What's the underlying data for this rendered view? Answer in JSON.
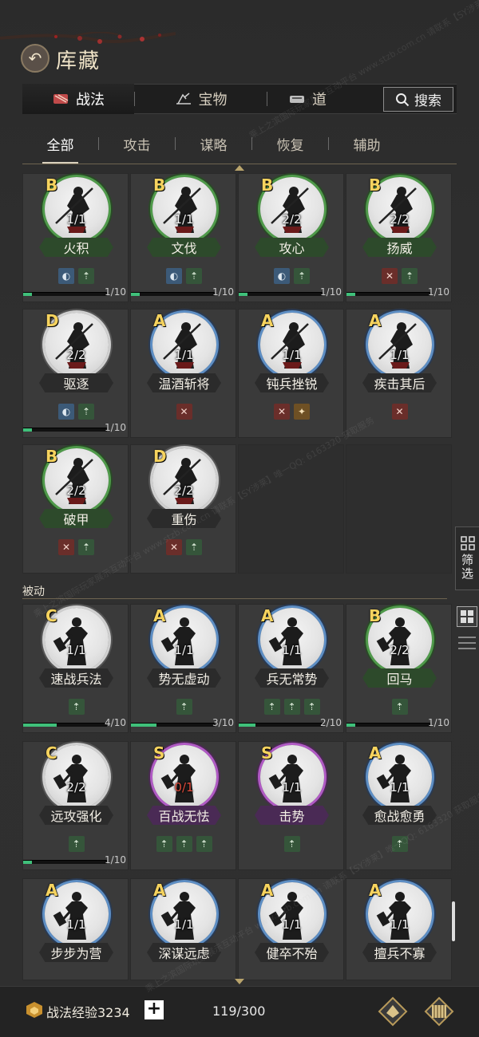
{
  "header": {
    "title": "库藏"
  },
  "main_tabs": [
    {
      "label": "战法",
      "icon": "skill-scroll-icon",
      "active": true
    },
    {
      "label": "宝物",
      "icon": "treasure-icon",
      "active": false
    },
    {
      "label": "道",
      "icon": "item-icon",
      "active": false
    }
  ],
  "search": {
    "label": "搜索"
  },
  "sub_tabs": [
    {
      "label": "全部",
      "active": true
    },
    {
      "label": "攻击",
      "active": false
    },
    {
      "label": "谋略",
      "active": false
    },
    {
      "label": "恢复",
      "active": false
    },
    {
      "label": "辅助",
      "active": false
    }
  ],
  "active_cards": [
    {
      "grade": "B",
      "count": "1/1",
      "name": "火积",
      "progress_text": "1/10",
      "progress": 0.1,
      "ring": "green",
      "tags": [
        "blue-tag",
        "green-tag"
      ]
    },
    {
      "grade": "B",
      "count": "1/1",
      "name": "文伐",
      "progress_text": "1/10",
      "progress": 0.1,
      "ring": "green",
      "tags": [
        "blue-tag",
        "green-tag"
      ]
    },
    {
      "grade": "B",
      "count": "2/2",
      "name": "攻心",
      "progress_text": "1/10",
      "progress": 0.1,
      "ring": "green",
      "tags": [
        "blue-tag",
        "green-tag"
      ]
    },
    {
      "grade": "B",
      "count": "2/2",
      "name": "扬威",
      "progress_text": "1/10",
      "progress": 0.1,
      "ring": "green",
      "tags": [
        "red-tag",
        "green-tag"
      ]
    },
    {
      "grade": "D",
      "count": "2/2",
      "name": "驱逐",
      "progress_text": "1/10",
      "progress": 0.1,
      "ring": "white",
      "tags": [
        "blue-tag",
        "green-tag"
      ]
    },
    {
      "grade": "A",
      "count": "1/1",
      "name": "温酒斩将",
      "progress_text": "",
      "progress": 0,
      "ring": "blue",
      "tags": [
        "red-tag"
      ]
    },
    {
      "grade": "A",
      "count": "1/1",
      "name": "钝兵挫锐",
      "progress_text": "",
      "progress": 0,
      "ring": "blue",
      "tags": [
        "red-tag",
        "amber-tag"
      ]
    },
    {
      "grade": "A",
      "count": "1/1",
      "name": "疾击其后",
      "progress_text": "",
      "progress": 0,
      "ring": "blue",
      "tags": [
        "red-tag"
      ]
    },
    {
      "grade": "B",
      "count": "2/2",
      "name": "破甲",
      "progress_text": "",
      "progress": 0,
      "ring": "green",
      "tags": [
        "red-tag",
        "green-tag"
      ]
    },
    {
      "grade": "D",
      "count": "2/2",
      "name": "重伤",
      "progress_text": "",
      "progress": 0,
      "ring": "white",
      "tags": [
        "red-tag",
        "green-tag"
      ]
    }
  ],
  "passive_section": {
    "title": "被动"
  },
  "passive_cards": [
    {
      "grade": "C",
      "count": "1/1",
      "name": "速战兵法",
      "progress_text": "4/10",
      "progress": 0.4,
      "ring": "white",
      "tags": [
        "green-tag"
      ]
    },
    {
      "grade": "A",
      "count": "1/1",
      "name": "势无虚动",
      "progress_text": "3/10",
      "progress": 0.3,
      "ring": "blue",
      "tags": [
        "green-tag"
      ]
    },
    {
      "grade": "A",
      "count": "1/1",
      "name": "兵无常势",
      "progress_text": "2/10",
      "progress": 0.2,
      "ring": "blue",
      "tags": [
        "green-tag",
        "green-tag",
        "green-tag"
      ]
    },
    {
      "grade": "B",
      "count": "2/2",
      "name": "回马",
      "progress_text": "1/10",
      "progress": 0.1,
      "ring": "green",
      "tags": [
        "green-tag"
      ]
    },
    {
      "grade": "C",
      "count": "2/2",
      "name": "远攻强化",
      "progress_text": "1/10",
      "progress": 0.1,
      "ring": "white",
      "tags": [
        "green-tag"
      ]
    },
    {
      "grade": "S",
      "count": "0/1",
      "name": "百战无怯",
      "progress_text": "",
      "progress": 0,
      "ring": "purple",
      "tags": [
        "green-tag",
        "green-tag",
        "green-tag"
      ]
    },
    {
      "grade": "S",
      "count": "1/1",
      "name": "击势",
      "progress_text": "",
      "progress": 0,
      "ring": "purple",
      "tags": [
        "green-tag"
      ]
    },
    {
      "grade": "A",
      "count": "1/1",
      "name": "愈战愈勇",
      "progress_text": "",
      "progress": 0,
      "ring": "blue",
      "tags": [
        "green-tag"
      ]
    },
    {
      "grade": "A",
      "count": "1/1",
      "name": "步步为营",
      "progress_text": "",
      "progress": 0,
      "ring": "blue",
      "tags": []
    },
    {
      "grade": "A",
      "count": "1/1",
      "name": "深谋远虑",
      "progress_text": "",
      "progress": 0,
      "ring": "blue",
      "tags": []
    },
    {
      "grade": "A",
      "count": "1/1",
      "name": "健卒不殆",
      "progress_text": "",
      "progress": 0,
      "ring": "blue",
      "tags": []
    },
    {
      "grade": "A",
      "count": "1/1",
      "name": "擅兵不寡",
      "progress_text": "",
      "progress": 0,
      "ring": "blue",
      "tags": []
    }
  ],
  "side": {
    "filter_label": "筛选"
  },
  "bottom": {
    "exp_label": "战法经验3234",
    "capacity": "119/300"
  },
  "watermark": {
    "text": "乘上之滨国际玩家展示互动平台 www.stzb.com.cn 请联系【SY涉莱】唯一QQ: 6163320 获取服务"
  },
  "colors": {
    "grade_text": "#f6d35e",
    "progress_fill": "#3fc07a",
    "ring_green": "#4f9a4a",
    "ring_blue": "#5d8ec4",
    "ring_purple": "#b05ac4",
    "ring_white": "#cfcfcf"
  }
}
